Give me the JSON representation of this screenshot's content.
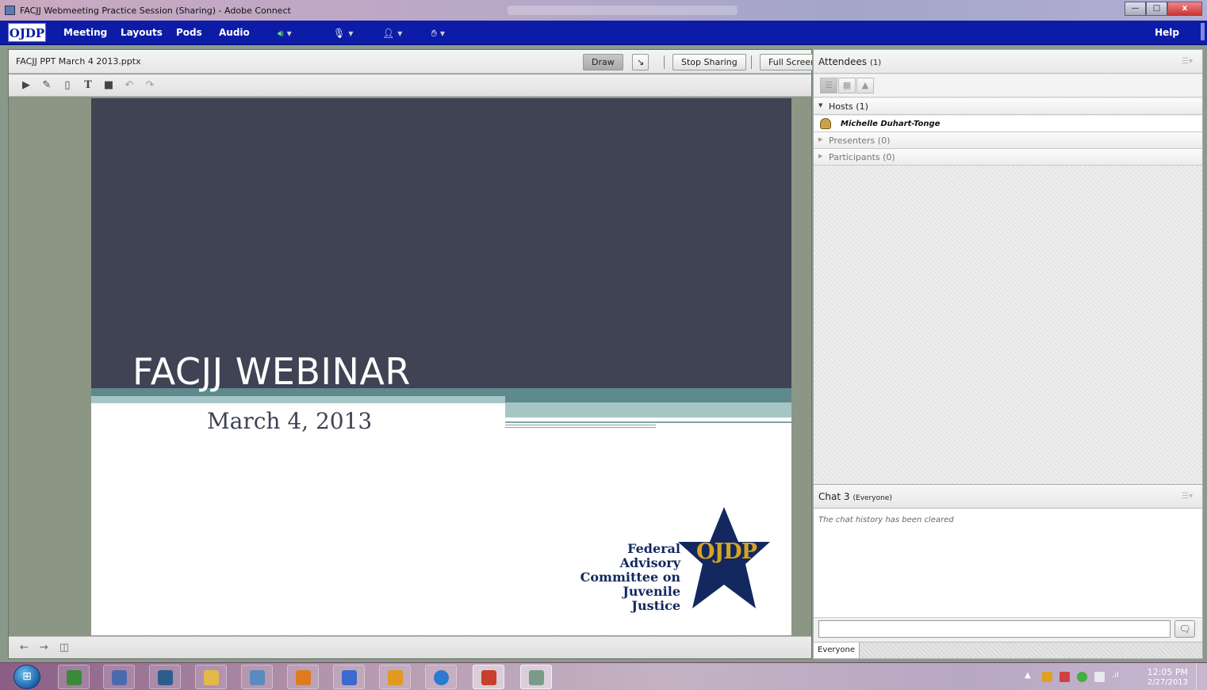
{
  "window": {
    "title": "FACJJ Webmeeting Practice Session (Sharing) - Adobe Connect",
    "minimize": "—",
    "maximize": "□",
    "close": "x"
  },
  "menubar": {
    "logo": "OJDP",
    "items": [
      "Meeting",
      "Layouts",
      "Pods",
      "Audio"
    ],
    "help": "Help",
    "speaker_color": "#6fe06f",
    "bar_color": "#0d1ca6"
  },
  "share_pod": {
    "title": "FACJJ PPT March 4 2013.pptx",
    "draw_label": "Draw",
    "stop_sharing_label": "Stop Sharing",
    "full_screen_label": "Full Screen",
    "tools": [
      "pointer-icon",
      "pencil-icon",
      "eraser-icon",
      "text-icon",
      "shape-icon",
      "undo-icon",
      "redo-icon"
    ]
  },
  "slide": {
    "title": "FACJJ WEBINAR",
    "date": "March 4, 2013",
    "org_line1": "Federal Advisory",
    "org_line2": "Committee on",
    "org_line3": "Juvenile Justice",
    "logo_text": "OJDP",
    "dark_color": "#404353",
    "teal_color": "#5e8a8d",
    "light_teal_color": "#a6c6c6",
    "star_color": "#13285e",
    "gold_color": "#d6a422"
  },
  "attendees": {
    "title": "Attendees",
    "count": "(1)",
    "hosts": "Hosts (1)",
    "host_name": "Michelle Duhart-Tonge",
    "presenters": "Presenters (0)",
    "participants": "Participants (0)"
  },
  "chat": {
    "title": "Chat 3",
    "scope": "(Everyone)",
    "history": "The chat history has been cleared",
    "input_placeholder": "",
    "to_tab": "Everyone"
  },
  "taskbar": {
    "time": "12:05 PM",
    "date": "2/27/2013"
  }
}
